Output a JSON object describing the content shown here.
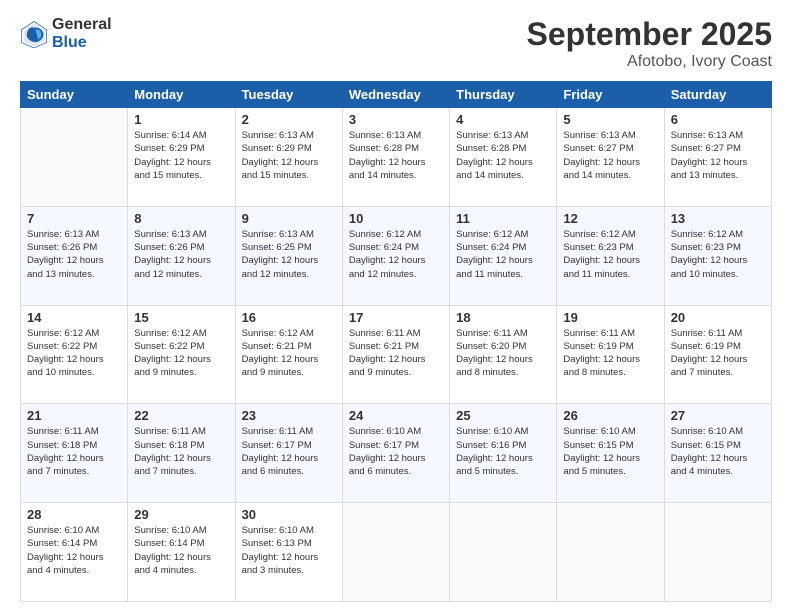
{
  "logo": {
    "general": "General",
    "blue": "Blue"
  },
  "title": "September 2025",
  "location": "Afotobo, Ivory Coast",
  "weekdays": [
    "Sunday",
    "Monday",
    "Tuesday",
    "Wednesday",
    "Thursday",
    "Friday",
    "Saturday"
  ],
  "weeks": [
    [
      {
        "day": "",
        "info": ""
      },
      {
        "day": "1",
        "info": "Sunrise: 6:14 AM\nSunset: 6:29 PM\nDaylight: 12 hours\nand 15 minutes."
      },
      {
        "day": "2",
        "info": "Sunrise: 6:13 AM\nSunset: 6:29 PM\nDaylight: 12 hours\nand 15 minutes."
      },
      {
        "day": "3",
        "info": "Sunrise: 6:13 AM\nSunset: 6:28 PM\nDaylight: 12 hours\nand 14 minutes."
      },
      {
        "day": "4",
        "info": "Sunrise: 6:13 AM\nSunset: 6:28 PM\nDaylight: 12 hours\nand 14 minutes."
      },
      {
        "day": "5",
        "info": "Sunrise: 6:13 AM\nSunset: 6:27 PM\nDaylight: 12 hours\nand 14 minutes."
      },
      {
        "day": "6",
        "info": "Sunrise: 6:13 AM\nSunset: 6:27 PM\nDaylight: 12 hours\nand 13 minutes."
      }
    ],
    [
      {
        "day": "7",
        "info": "Sunrise: 6:13 AM\nSunset: 6:26 PM\nDaylight: 12 hours\nand 13 minutes."
      },
      {
        "day": "8",
        "info": "Sunrise: 6:13 AM\nSunset: 6:26 PM\nDaylight: 12 hours\nand 12 minutes."
      },
      {
        "day": "9",
        "info": "Sunrise: 6:13 AM\nSunset: 6:25 PM\nDaylight: 12 hours\nand 12 minutes."
      },
      {
        "day": "10",
        "info": "Sunrise: 6:12 AM\nSunset: 6:24 PM\nDaylight: 12 hours\nand 12 minutes."
      },
      {
        "day": "11",
        "info": "Sunrise: 6:12 AM\nSunset: 6:24 PM\nDaylight: 12 hours\nand 11 minutes."
      },
      {
        "day": "12",
        "info": "Sunrise: 6:12 AM\nSunset: 6:23 PM\nDaylight: 12 hours\nand 11 minutes."
      },
      {
        "day": "13",
        "info": "Sunrise: 6:12 AM\nSunset: 6:23 PM\nDaylight: 12 hours\nand 10 minutes."
      }
    ],
    [
      {
        "day": "14",
        "info": "Sunrise: 6:12 AM\nSunset: 6:22 PM\nDaylight: 12 hours\nand 10 minutes."
      },
      {
        "day": "15",
        "info": "Sunrise: 6:12 AM\nSunset: 6:22 PM\nDaylight: 12 hours\nand 9 minutes."
      },
      {
        "day": "16",
        "info": "Sunrise: 6:12 AM\nSunset: 6:21 PM\nDaylight: 12 hours\nand 9 minutes."
      },
      {
        "day": "17",
        "info": "Sunrise: 6:11 AM\nSunset: 6:21 PM\nDaylight: 12 hours\nand 9 minutes."
      },
      {
        "day": "18",
        "info": "Sunrise: 6:11 AM\nSunset: 6:20 PM\nDaylight: 12 hours\nand 8 minutes."
      },
      {
        "day": "19",
        "info": "Sunrise: 6:11 AM\nSunset: 6:19 PM\nDaylight: 12 hours\nand 8 minutes."
      },
      {
        "day": "20",
        "info": "Sunrise: 6:11 AM\nSunset: 6:19 PM\nDaylight: 12 hours\nand 7 minutes."
      }
    ],
    [
      {
        "day": "21",
        "info": "Sunrise: 6:11 AM\nSunset: 6:18 PM\nDaylight: 12 hours\nand 7 minutes."
      },
      {
        "day": "22",
        "info": "Sunrise: 6:11 AM\nSunset: 6:18 PM\nDaylight: 12 hours\nand 7 minutes."
      },
      {
        "day": "23",
        "info": "Sunrise: 6:11 AM\nSunset: 6:17 PM\nDaylight: 12 hours\nand 6 minutes."
      },
      {
        "day": "24",
        "info": "Sunrise: 6:10 AM\nSunset: 6:17 PM\nDaylight: 12 hours\nand 6 minutes."
      },
      {
        "day": "25",
        "info": "Sunrise: 6:10 AM\nSunset: 6:16 PM\nDaylight: 12 hours\nand 5 minutes."
      },
      {
        "day": "26",
        "info": "Sunrise: 6:10 AM\nSunset: 6:15 PM\nDaylight: 12 hours\nand 5 minutes."
      },
      {
        "day": "27",
        "info": "Sunrise: 6:10 AM\nSunset: 6:15 PM\nDaylight: 12 hours\nand 4 minutes."
      }
    ],
    [
      {
        "day": "28",
        "info": "Sunrise: 6:10 AM\nSunset: 6:14 PM\nDaylight: 12 hours\nand 4 minutes."
      },
      {
        "day": "29",
        "info": "Sunrise: 6:10 AM\nSunset: 6:14 PM\nDaylight: 12 hours\nand 4 minutes."
      },
      {
        "day": "30",
        "info": "Sunrise: 6:10 AM\nSunset: 6:13 PM\nDaylight: 12 hours\nand 3 minutes."
      },
      {
        "day": "",
        "info": ""
      },
      {
        "day": "",
        "info": ""
      },
      {
        "day": "",
        "info": ""
      },
      {
        "day": "",
        "info": ""
      }
    ]
  ]
}
